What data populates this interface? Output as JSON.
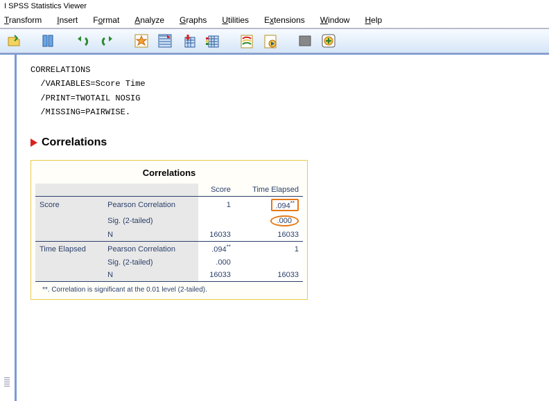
{
  "title": "I SPSS Statistics Viewer",
  "menu": [
    "Transform",
    "Insert",
    "Format",
    "Analyze",
    "Graphs",
    "Utilities",
    "Extensions",
    "Window",
    "Help"
  ],
  "syntax": {
    "l1": "CORRELATIONS",
    "l2": "  /VARIABLES=Score Time",
    "l3": "  /PRINT=TWOTAIL NOSIG",
    "l4": "  /MISSING=PAIRWISE."
  },
  "section_heading": "Correlations",
  "table": {
    "title": "Correlations",
    "col1": "Score",
    "col2": "Time Elapsed",
    "rows": [
      {
        "var": "Score",
        "stat": "Pearson Correlation",
        "v1": "1",
        "v2": ".094",
        "v2sup": "**",
        "hl": "rect"
      },
      {
        "var": "",
        "stat": "Sig. (2-tailed)",
        "v1": "",
        "v2": ".000",
        "hl": "oval"
      },
      {
        "var": "",
        "stat": "N",
        "v1": "16033",
        "v2": "16033"
      },
      {
        "var": "Time Elapsed",
        "stat": "Pearson Correlation",
        "v1": ".094",
        "v1sup": "**",
        "v2": "1"
      },
      {
        "var": "",
        "stat": "Sig. (2-tailed)",
        "v1": ".000",
        "v2": ""
      },
      {
        "var": "",
        "stat": "N",
        "v1": "16033",
        "v2": "16033"
      }
    ],
    "footnote": "**. Correlation is significant at the 0.01 level (2-tailed)."
  },
  "icons": [
    "open",
    "chart-cols",
    "undo",
    "redo",
    "star-doc",
    "grid-doc",
    "arrow-down-grid",
    "stack-grid",
    "page-wave",
    "page-play",
    "grey-box",
    "plus-circle"
  ]
}
